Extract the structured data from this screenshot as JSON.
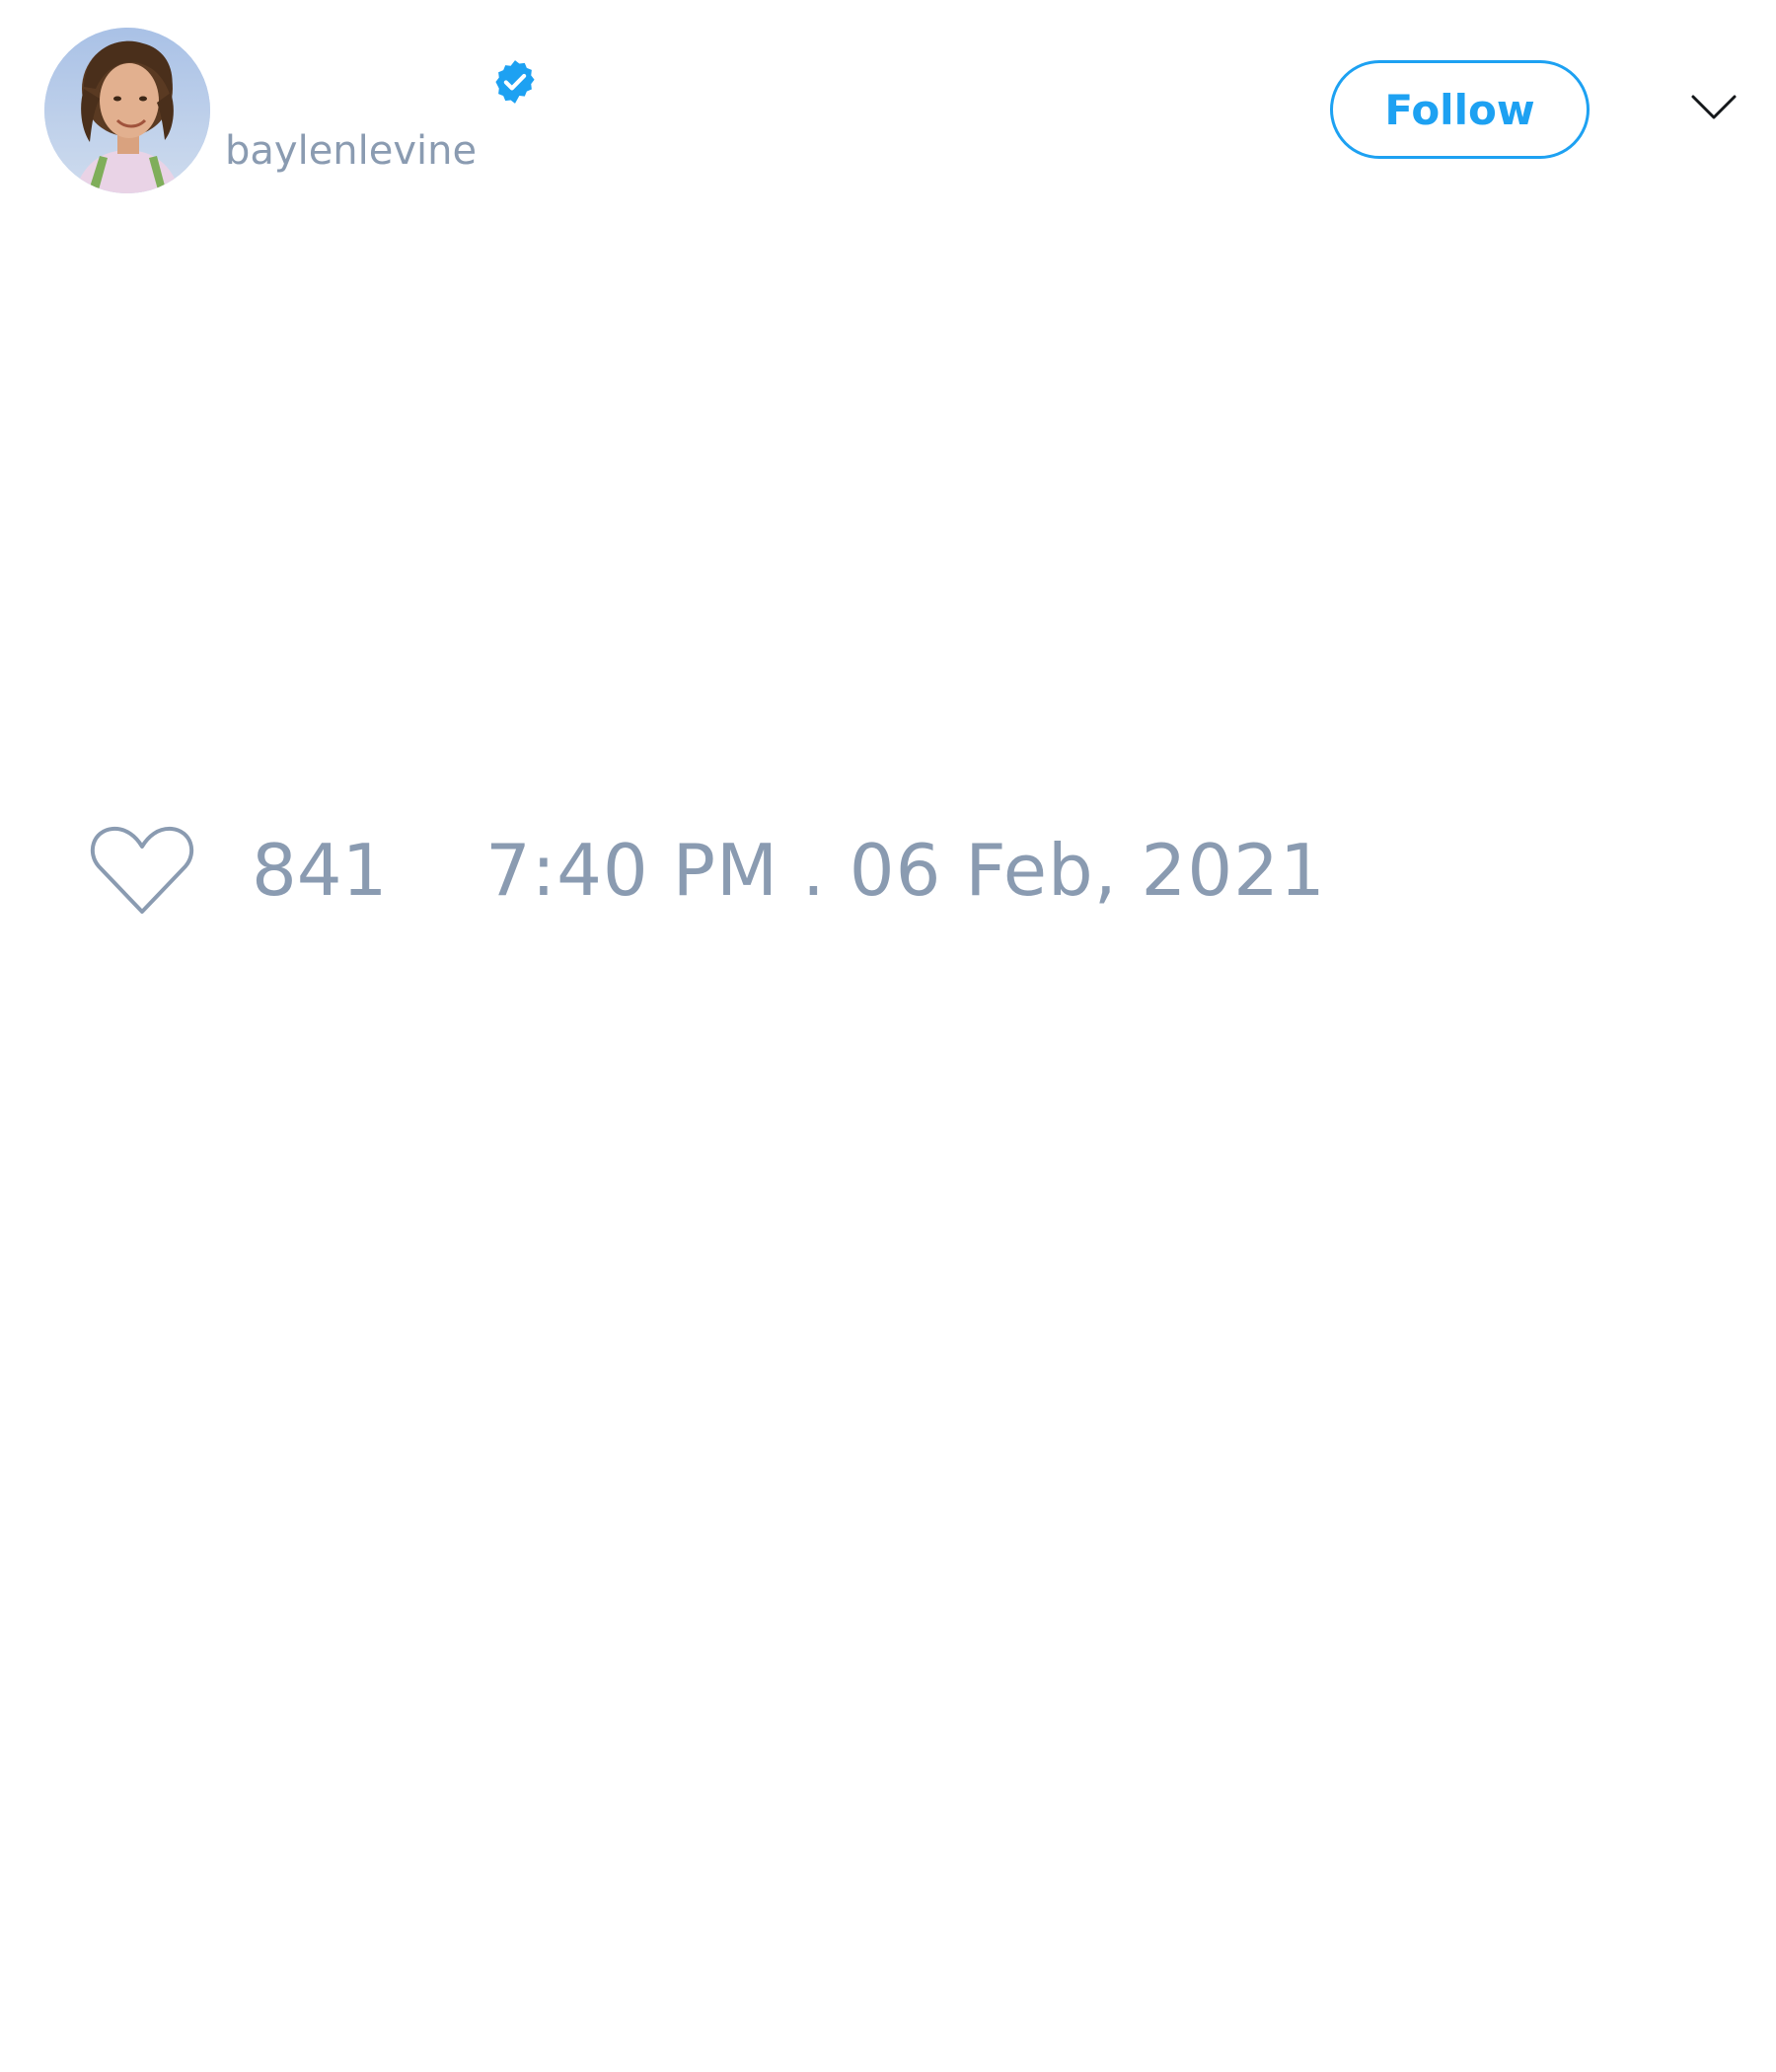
{
  "tweet": {
    "author": {
      "display_name": "",
      "username": "baylenlevine",
      "verified": true,
      "avatar_icon": "profile-photo"
    },
    "follow_label": "Follow",
    "menu_icon": "chevron-down-icon",
    "likes": {
      "icon": "heart-icon",
      "count": "841"
    },
    "timestamp": "7:40 PM . 06 Feb, 2021"
  },
  "colors": {
    "accent": "#1da1f2",
    "muted_text": "#8a9bb1",
    "icon_stroke": "#8a9bb1",
    "background": "#ffffff"
  }
}
